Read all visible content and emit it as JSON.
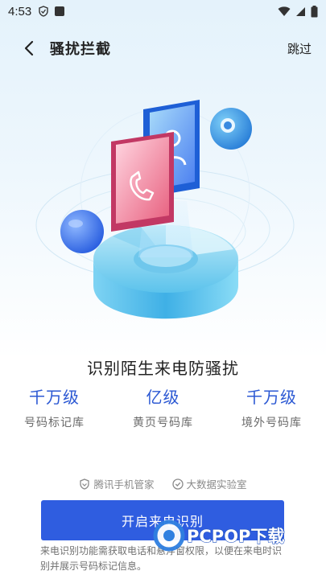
{
  "status_bar": {
    "time": "4:53"
  },
  "header": {
    "title": "骚扰拦截",
    "skip_label": "跳过"
  },
  "headline": "识别陌生来电防骚扰",
  "stats": [
    {
      "value": "千万级",
      "label": "号码标记库"
    },
    {
      "value": "亿级",
      "label": "黄页号码库"
    },
    {
      "value": "千万级",
      "label": "境外号码库"
    }
  ],
  "partners": [
    {
      "icon": "shield-icon",
      "label": "腾讯手机管家"
    },
    {
      "icon": "check-shield-icon",
      "label": "大数据实验室"
    }
  ],
  "action_button": "开启来电识别",
  "notice": "来电识别功能需获取电话和悬浮窗权限，以便在来电时识别并展示号码标记信息。",
  "watermark": {
    "text": "PCPOP下载"
  },
  "colors": {
    "accent": "#2f5de0",
    "stat_value": "#2b58d3",
    "phone_card": "#e8607f",
    "contact_card": "#4a7ef0"
  }
}
